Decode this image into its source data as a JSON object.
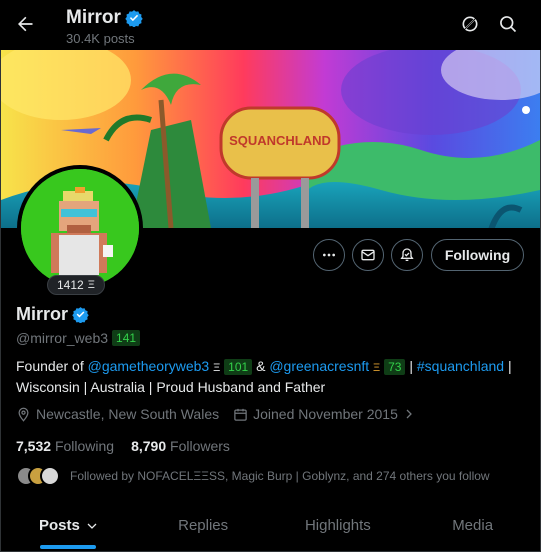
{
  "header": {
    "name": "Mirror",
    "posts_count": "30.4K posts"
  },
  "avatar_badge": "1412",
  "buttons": {
    "following": "Following"
  },
  "profile": {
    "name": "Mirror",
    "handle": "@mirror_web3",
    "handle_score": "141"
  },
  "bio": {
    "prefix": "Founder of ",
    "link1": "@gametheoryweb3",
    "score1": "101",
    "amp": " & ",
    "link2": "@greenacresnft",
    "score2": "73",
    "sep": " | ",
    "hashtag": "#squanchland",
    "line2": " | Wisconsin | Australia | Proud Husband and Father"
  },
  "meta": {
    "location": "Newcastle, New South Wales",
    "joined": "Joined November 2015"
  },
  "stats": {
    "following_count": "7,532",
    "following_label": "Following",
    "followers_count": "8,790",
    "followers_label": "Followers"
  },
  "followed_by": "Followed by NOFACELΞΞSS, Magic Burp | Goblynz, and 274 others you follow",
  "tabs": {
    "posts": "Posts",
    "replies": "Replies",
    "highlights": "Highlights",
    "media": "Media"
  },
  "colors": {
    "accent": "#1d9bf0",
    "verified": "#1d9bf0",
    "score_green": "#33d14a"
  }
}
